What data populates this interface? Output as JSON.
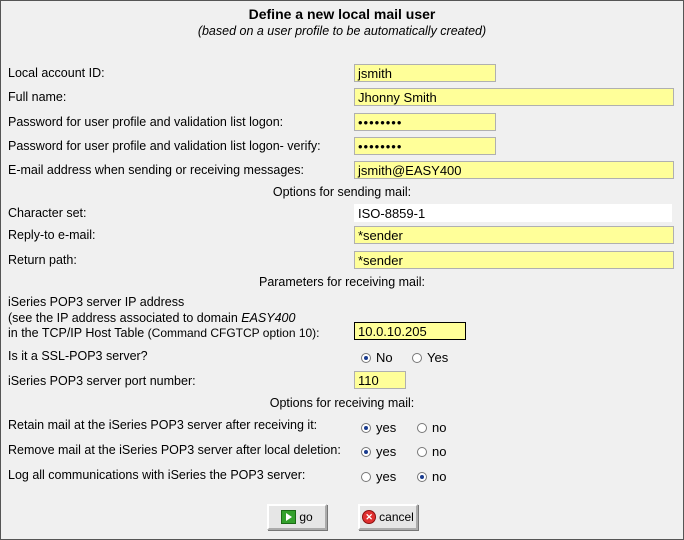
{
  "header": {
    "title": "Define a new local mail user",
    "subtitle": "(based on a user profile to be automatically created)"
  },
  "account": {
    "id_label": "Local account ID:",
    "id_value": "jsmith",
    "fullname_label": "Full name:",
    "fullname_value": "Jhonny Smith",
    "password_label": "Password for user profile and validation list logon:",
    "password_value": "••••••••",
    "password_verify_label": "Password for user profile and validation list logon- verify:",
    "password_verify_value": "••••••••",
    "email_label": "E-mail address when sending or receiving messages:",
    "email_value": "jsmith@EASY400"
  },
  "sending": {
    "section_title": "Options for sending mail:",
    "charset_label": "Character set:",
    "charset_value": "ISO-8859-1",
    "replyto_label": "Reply-to e-mail:",
    "replyto_value": "*sender",
    "returnpath_label": "Return path:",
    "returnpath_value": "*sender"
  },
  "receiving_params": {
    "section_title": "Parameters for receiving mail:",
    "ip_label_line1": "iSeries POP3 server IP address",
    "ip_label_line2_prefix": "(see the IP address associated to domain ",
    "ip_label_line2_domain": "EASY400",
    "ip_label_line3_prefix": "in the TCP/IP Host Table ",
    "ip_label_line3_cmd": "(Command CFGTCP option 10):",
    "ip_value": "10.0.10.205",
    "ssl_label": "Is it a SSL-POP3 server?",
    "ssl_no": "No",
    "ssl_yes": "Yes",
    "ssl_selected": "No",
    "port_label": "iSeries POP3 server port number:",
    "port_value": "110"
  },
  "receiving_options": {
    "section_title": "Options for receiving mail:",
    "retain_label": "Retain mail at the iSeries POP3 server after receiving it:",
    "retain_selected": "yes",
    "remove_label": "Remove mail at the iSeries POP3 server after local deletion:",
    "remove_selected": "yes",
    "log_label": "Log all communications with iSeries the POP3 server:",
    "log_selected": "no",
    "yes": "yes",
    "no": "no"
  },
  "buttons": {
    "go": "go",
    "cancel": "cancel"
  },
  "colors": {
    "field_bg": "#ffff99",
    "radio_dot": "#1a3c8f",
    "go_icon": "#33a02c",
    "cancel_icon": "#e03030"
  }
}
